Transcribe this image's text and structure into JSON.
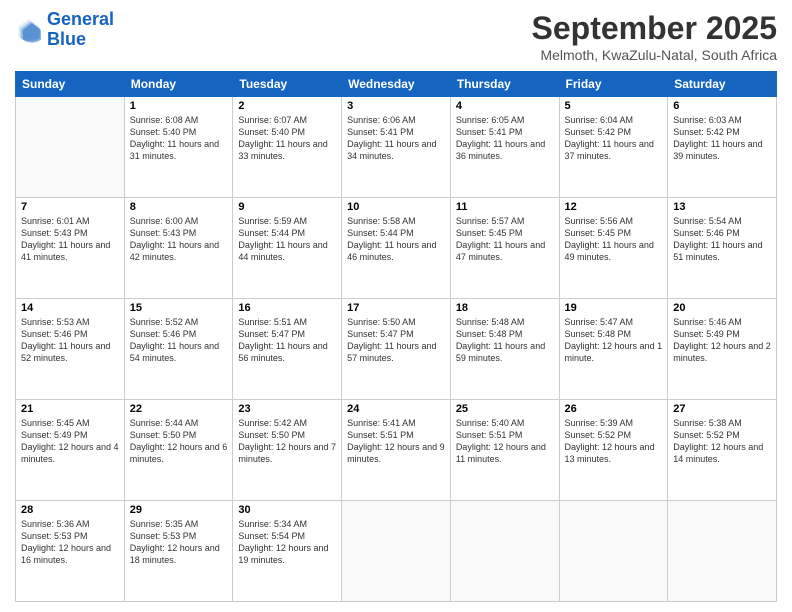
{
  "logo": {
    "line1": "General",
    "line2": "Blue"
  },
  "header": {
    "month": "September 2025",
    "location": "Melmoth, KwaZulu-Natal, South Africa"
  },
  "weekdays": [
    "Sunday",
    "Monday",
    "Tuesday",
    "Wednesday",
    "Thursday",
    "Friday",
    "Saturday"
  ],
  "weeks": [
    [
      {
        "day": "",
        "content": ""
      },
      {
        "day": "1",
        "content": "Sunrise: 6:08 AM\nSunset: 5:40 PM\nDaylight: 11 hours\nand 31 minutes."
      },
      {
        "day": "2",
        "content": "Sunrise: 6:07 AM\nSunset: 5:40 PM\nDaylight: 11 hours\nand 33 minutes."
      },
      {
        "day": "3",
        "content": "Sunrise: 6:06 AM\nSunset: 5:41 PM\nDaylight: 11 hours\nand 34 minutes."
      },
      {
        "day": "4",
        "content": "Sunrise: 6:05 AM\nSunset: 5:41 PM\nDaylight: 11 hours\nand 36 minutes."
      },
      {
        "day": "5",
        "content": "Sunrise: 6:04 AM\nSunset: 5:42 PM\nDaylight: 11 hours\nand 37 minutes."
      },
      {
        "day": "6",
        "content": "Sunrise: 6:03 AM\nSunset: 5:42 PM\nDaylight: 11 hours\nand 39 minutes."
      }
    ],
    [
      {
        "day": "7",
        "content": "Sunrise: 6:01 AM\nSunset: 5:43 PM\nDaylight: 11 hours\nand 41 minutes."
      },
      {
        "day": "8",
        "content": "Sunrise: 6:00 AM\nSunset: 5:43 PM\nDaylight: 11 hours\nand 42 minutes."
      },
      {
        "day": "9",
        "content": "Sunrise: 5:59 AM\nSunset: 5:44 PM\nDaylight: 11 hours\nand 44 minutes."
      },
      {
        "day": "10",
        "content": "Sunrise: 5:58 AM\nSunset: 5:44 PM\nDaylight: 11 hours\nand 46 minutes."
      },
      {
        "day": "11",
        "content": "Sunrise: 5:57 AM\nSunset: 5:45 PM\nDaylight: 11 hours\nand 47 minutes."
      },
      {
        "day": "12",
        "content": "Sunrise: 5:56 AM\nSunset: 5:45 PM\nDaylight: 11 hours\nand 49 minutes."
      },
      {
        "day": "13",
        "content": "Sunrise: 5:54 AM\nSunset: 5:46 PM\nDaylight: 11 hours\nand 51 minutes."
      }
    ],
    [
      {
        "day": "14",
        "content": "Sunrise: 5:53 AM\nSunset: 5:46 PM\nDaylight: 11 hours\nand 52 minutes."
      },
      {
        "day": "15",
        "content": "Sunrise: 5:52 AM\nSunset: 5:46 PM\nDaylight: 11 hours\nand 54 minutes."
      },
      {
        "day": "16",
        "content": "Sunrise: 5:51 AM\nSunset: 5:47 PM\nDaylight: 11 hours\nand 56 minutes."
      },
      {
        "day": "17",
        "content": "Sunrise: 5:50 AM\nSunset: 5:47 PM\nDaylight: 11 hours\nand 57 minutes."
      },
      {
        "day": "18",
        "content": "Sunrise: 5:48 AM\nSunset: 5:48 PM\nDaylight: 11 hours\nand 59 minutes."
      },
      {
        "day": "19",
        "content": "Sunrise: 5:47 AM\nSunset: 5:48 PM\nDaylight: 12 hours\nand 1 minute."
      },
      {
        "day": "20",
        "content": "Sunrise: 5:46 AM\nSunset: 5:49 PM\nDaylight: 12 hours\nand 2 minutes."
      }
    ],
    [
      {
        "day": "21",
        "content": "Sunrise: 5:45 AM\nSunset: 5:49 PM\nDaylight: 12 hours\nand 4 minutes."
      },
      {
        "day": "22",
        "content": "Sunrise: 5:44 AM\nSunset: 5:50 PM\nDaylight: 12 hours\nand 6 minutes."
      },
      {
        "day": "23",
        "content": "Sunrise: 5:42 AM\nSunset: 5:50 PM\nDaylight: 12 hours\nand 7 minutes."
      },
      {
        "day": "24",
        "content": "Sunrise: 5:41 AM\nSunset: 5:51 PM\nDaylight: 12 hours\nand 9 minutes."
      },
      {
        "day": "25",
        "content": "Sunrise: 5:40 AM\nSunset: 5:51 PM\nDaylight: 12 hours\nand 11 minutes."
      },
      {
        "day": "26",
        "content": "Sunrise: 5:39 AM\nSunset: 5:52 PM\nDaylight: 12 hours\nand 13 minutes."
      },
      {
        "day": "27",
        "content": "Sunrise: 5:38 AM\nSunset: 5:52 PM\nDaylight: 12 hours\nand 14 minutes."
      }
    ],
    [
      {
        "day": "28",
        "content": "Sunrise: 5:36 AM\nSunset: 5:53 PM\nDaylight: 12 hours\nand 16 minutes."
      },
      {
        "day": "29",
        "content": "Sunrise: 5:35 AM\nSunset: 5:53 PM\nDaylight: 12 hours\nand 18 minutes."
      },
      {
        "day": "30",
        "content": "Sunrise: 5:34 AM\nSunset: 5:54 PM\nDaylight: 12 hours\nand 19 minutes."
      },
      {
        "day": "",
        "content": ""
      },
      {
        "day": "",
        "content": ""
      },
      {
        "day": "",
        "content": ""
      },
      {
        "day": "",
        "content": ""
      }
    ]
  ]
}
